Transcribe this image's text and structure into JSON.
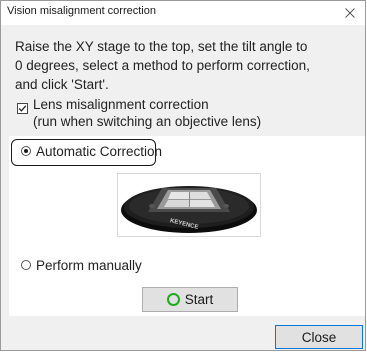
{
  "window": {
    "title": "Vision misalignment correction",
    "close_glyph": "×"
  },
  "instruction": {
    "line1": "Raise the XY stage to the top, set the tilt angle to",
    "line2": "0 degrees, select a method to perform correction,",
    "line3": "and click 'Start'."
  },
  "lens_option": {
    "checked": true,
    "line1": "Lens misalignment correction",
    "line2": "(run when switching an objective lens)"
  },
  "methods": {
    "selected": "automatic",
    "automatic_label": "Automatic Correction",
    "manual_label": "Perform manually"
  },
  "stage_image": {
    "icon": "xy-stage-image",
    "brand_text": "KEYENCE"
  },
  "buttons": {
    "start_label": "Start",
    "close_label": "Close"
  },
  "colors": {
    "start_icon": "#1faa1f",
    "close_focus_border": "#0078d7"
  }
}
